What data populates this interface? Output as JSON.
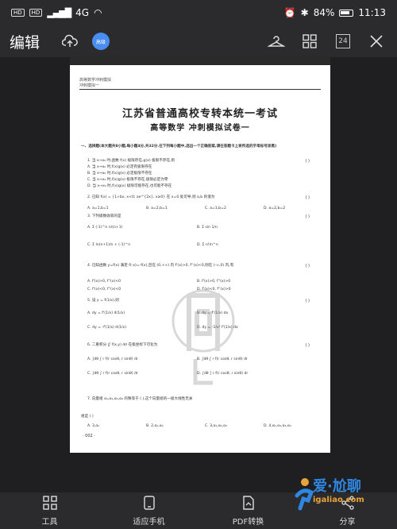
{
  "status_bar": {
    "chips": [
      "HD",
      "HD"
    ],
    "signal": "4G",
    "battery_pct": "84%",
    "time": "11:13"
  },
  "toolbar": {
    "title": "编辑",
    "badge_label": "高级",
    "page_count": "24",
    "icons": [
      "upload-cloud-icon",
      "badge-icon",
      "hanger-icon",
      "grid-icon",
      "page-count-icon",
      "close-icon"
    ]
  },
  "document": {
    "header_small": [
      "高等数学冲刺模拟",
      "冲刺模拟一"
    ],
    "title": "江苏省普通高校专转本统一考试",
    "subtitle": "高等数学    冲刺模拟试卷一",
    "section_intro": "一、选择题(本大题共8小题,每小题4分,共32分.在下列每小题中,选出一个正确答案,请在答题卡上将所选的字母标号涂黑)",
    "q1": "1. 当 x→x₀ 时,函数 f(x) 极限存在,g(x) 极限不存在,则",
    "q1_options": [
      "A. 当 x→x₀ 时,f(x)g(x) 必定有极限存在",
      "B. 当 x→x₀ 时,f(x)g(x) 必定极限不存在",
      "C. 当 x→x₀ 时,f(x)g(x) 极限不存在,极限必定为零",
      "D. 当 x→x₀ 时,f(x)g(x) 极限可能存在,也可能不存在"
    ],
    "q2": "2. 已知 f(x) = {1+bx, x<0; ae^{2x}, x≥0} 在 x=0 处可导,则 a,b 的值为",
    "q2_options": [
      "A. a=1,b=1",
      "B. a=2,b=1",
      "C. a=1,b=2",
      "D. a=2,b=2"
    ],
    "q3": "3. 下列级数收敛的是",
    "q3_options": [
      "A. Σ (-1)^n n/(n+1)",
      "B. Σ sin 1/n",
      "C. Σ ln(n+1)/n + (-1)^n",
      "D. Σ n!/n^n"
    ],
    "q4": "4. 已知函数 y=f(x) 满足 f(-x)=-f(x),且在 (0,+∞) 内 f'(x)>0, f''(x)<0,则在 (-∞,0) 内,有",
    "q4_options": [
      "A. f'(x)>0, f''(x)<0",
      "B. f'(x)>0, f''(x)>0",
      "C. f'(x)<0, f''(x)<0",
      "D. f'(x)<0, f''(x)>0"
    ],
    "q5": "5. 设 y = f(1/x),则",
    "q5_options": [
      "A. dy = f'(1/x) d(1/x)",
      "B. dy = f'(1/x) dx",
      "C. dy = -f'(1/x) d(1/x)",
      "D. dy = -1/x² f'(1/x) dx"
    ],
    "q6": "6. 二重积分 ∬ f(x,y) dσ 在极坐标下可化为",
    "q6_options": [
      "A. ∫dθ ∫ r f(r cosθ, r sinθ) dr",
      "B. ∫dθ ∫ r f(r cosθ, r sinθ) dr",
      "C. ∫dθ ∫ r f(r cosθ, r sinθ) dr",
      "D. ∫dθ ∫ r f(r cosθ, r sinθ) dr"
    ],
    "q7": "7. 向量组 α₁,α₂,α₃,α₄ 的秩等于 (  ),这个向量组的一极大线性无关",
    "q7_tail": "组是 (  )",
    "q7_options": [
      "A. 3,α₁",
      "B. 2,α₁,α₂",
      "C. 3,α₁,α₂,α₃",
      "D. 4,α₁,α₂,α₃,α₄"
    ],
    "paren": "(      )",
    "footer": "· 002 ·"
  },
  "bottom_bar": {
    "items": [
      {
        "label": "工具",
        "icon": "tools-grid-icon"
      },
      {
        "label": "适应手机",
        "icon": "phone-fit-icon"
      },
      {
        "label": "PDF转换",
        "icon": "pdf-convert-icon"
      },
      {
        "label": "分享",
        "icon": "share-icon"
      }
    ]
  },
  "site_logo": {
    "cn": "爱·尬聊",
    "url": "igaliao.com"
  }
}
